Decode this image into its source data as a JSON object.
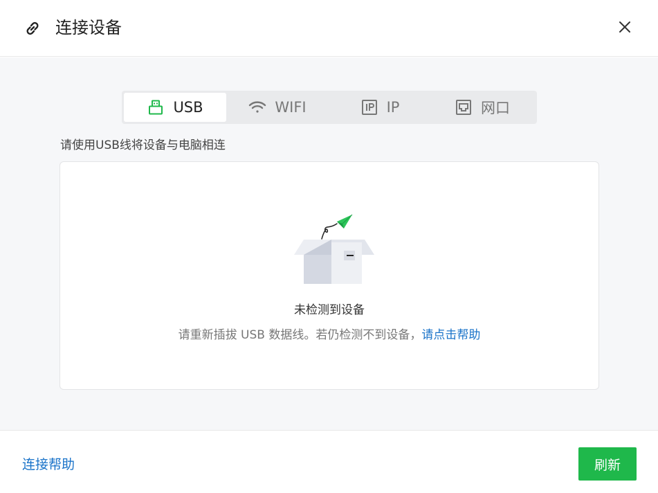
{
  "dialog": {
    "title": "连接设备",
    "title_icon": "link-icon",
    "close_icon": "close-icon"
  },
  "tabs": [
    {
      "label": "USB",
      "icon": "usb-icon",
      "active": true
    },
    {
      "label": "WIFI",
      "icon": "wifi-icon",
      "active": false
    },
    {
      "label": "IP",
      "icon": "ip-icon",
      "active": false
    },
    {
      "label": "网口",
      "icon": "ethernet-port-icon",
      "active": false
    }
  ],
  "hint": "请使用USB线将设备与电脑相连",
  "empty_state": {
    "illustration": "empty-box-paper-plane-illustration",
    "title": "未检测到设备",
    "description": "请重新插拔 USB 数据线。若仍检测不到设备，",
    "help_link": "请点击帮助"
  },
  "footer": {
    "help_link": "连接帮助",
    "refresh_label": "刷新"
  },
  "colors": {
    "accent_green": "#1fb84b",
    "link_blue": "#1a73c9",
    "body_bg": "#f6f7f9"
  }
}
